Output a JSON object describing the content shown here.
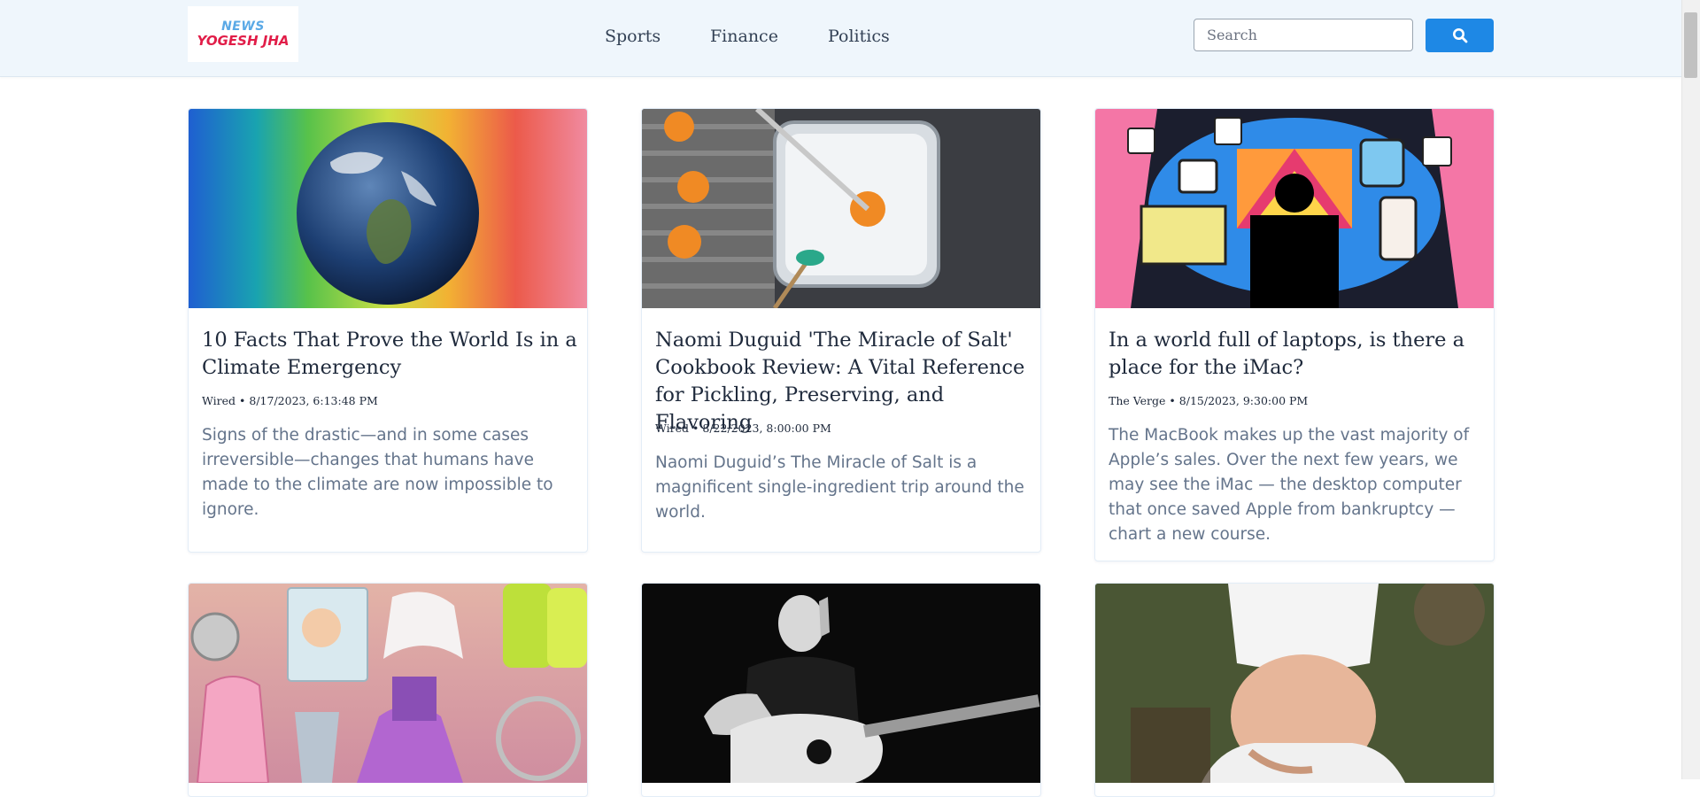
{
  "logo": {
    "line1": "NEWS",
    "line2": "YOGESH JHA"
  },
  "nav": {
    "items": [
      {
        "label": "Sports"
      },
      {
        "label": "Finance"
      },
      {
        "label": "Politics"
      }
    ]
  },
  "search": {
    "placeholder": "Search",
    "value": "",
    "button_icon": "search-icon"
  },
  "colors": {
    "accent": "#1e88e5",
    "header_bg": "#eff6fc",
    "headline": "#1e293b",
    "body_text": "#64748b"
  },
  "articles": [
    {
      "title": "10 Facts That Prove the World Is in a Climate Emergency",
      "source": "Wired",
      "date": "8/17/2023, 6:13:48 PM",
      "description": "Signs of the drastic—and in some cases irreversible—changes that humans have made to the climate are now impossible to ignore.",
      "image": "earth-rainbow-image"
    },
    {
      "title": "Naomi Duguid 'The Miracle of Salt' Cookbook Review: A Vital Reference for Pickling, Preserving, and Flavoring",
      "source": "Wired",
      "date": "8/22/2023, 8:00:00 PM",
      "description": "Naomi Duguid’s The Miracle of Salt is a magnificent single-ingredient trip around the world.",
      "image": "salt-dish-image"
    },
    {
      "title": "In a world full of laptops, is there a place for the iMac?",
      "source": "The Verge",
      "date": "8/15/2023, 9:30:00 PM",
      "description": "The MacBook makes up the vast majority of Apple’s sales. Over the next few years, we may see the iMac — the desktop computer that once saved Apple from bankruptcy — chart a new course.",
      "image": "imac-illustration-image"
    },
    {
      "image": "disney-merch-image"
    },
    {
      "image": "guitar-singer-image"
    },
    {
      "image": "pregnant-person-image"
    }
  ]
}
